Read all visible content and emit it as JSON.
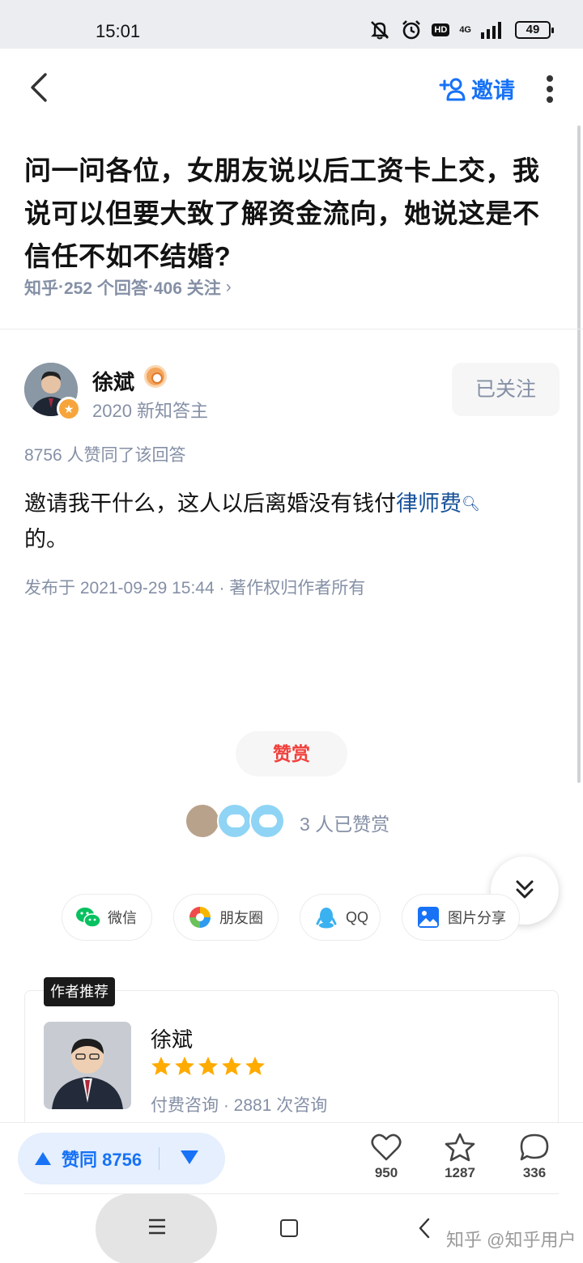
{
  "status_bar": {
    "time": "15:01",
    "network": "4G",
    "hd": "HD",
    "battery": "49"
  },
  "nav": {
    "invite_label": "邀请"
  },
  "question": {
    "title": "问一问各位，女朋友说以后工资卡上交，我说可以但要大致了解资金流向，她说这是不信任不如不结婚?",
    "source": "知乎",
    "answers": "252 个回答",
    "followers": "406 关注"
  },
  "author": {
    "name": "徐斌",
    "subtitle": "2020 新知答主",
    "follow_label": "已关注"
  },
  "answer": {
    "vote_summary": "8756 人赞同了该回答",
    "body_before": "邀请我干什么，这人以后离婚没有钱付",
    "body_link": "律师费",
    "body_after": "的。",
    "meta": "发布于 2021-09-29 15:44 · 著作权归作者所有"
  },
  "reward": {
    "button_label": "赞赏",
    "count_text": "3 人已赞赏"
  },
  "share": {
    "wechat": "微信",
    "moments": "朋友圈",
    "qq": "QQ",
    "image": "图片分享"
  },
  "recommend": {
    "label": "作者推荐",
    "name": "徐斌",
    "rating": 5,
    "meta": "付费咨询 · 2881 次咨询"
  },
  "actions": {
    "vote_label": "赞同 8756",
    "likes": "950",
    "favorites": "1287",
    "comments": "336"
  },
  "watermark": "知乎 @知乎用户",
  "colors": {
    "brand_blue": "#1772f6",
    "reward_red": "#f1403c",
    "star_orange": "#ffab00"
  }
}
